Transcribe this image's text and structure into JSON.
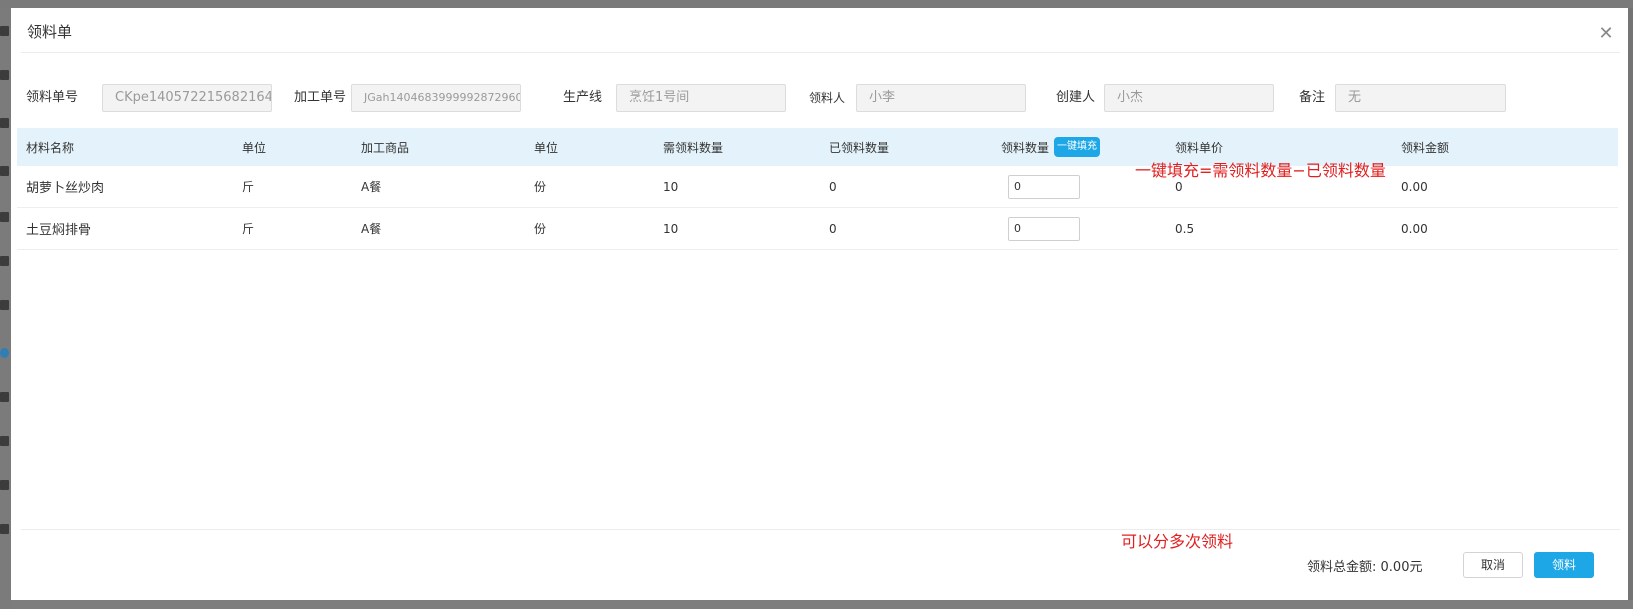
{
  "dialog": {
    "title": "领料单",
    "close_icon": "close-icon"
  },
  "form": {
    "order_no": {
      "label": "领料单号",
      "value": "CKpe140572215682164"
    },
    "process_no": {
      "label": "加工单号",
      "value": "JGah1404683999992872960"
    },
    "production_line": {
      "label": "生产线",
      "value": "烹饪1号间"
    },
    "receiver": {
      "label": "领料人",
      "value": "小李"
    },
    "creator": {
      "label": "创建人",
      "value": "小杰"
    },
    "remark": {
      "label": "备注",
      "value": "无"
    }
  },
  "table": {
    "headers": {
      "material_name": "材料名称",
      "unit": "单位",
      "product": "加工商品",
      "product_unit": "单位",
      "required_qty": "需领料数量",
      "received_qty": "已领料数量",
      "pick_qty": "领料数量",
      "fill_button": "一键填充",
      "unit_price": "领料单价",
      "amount": "领料金额"
    },
    "rows": [
      {
        "material_name": "胡萝卜丝炒肉",
        "unit": "斤",
        "product": "A餐",
        "product_unit": "份",
        "required_qty": "10",
        "received_qty": "0",
        "pick_qty": "0",
        "unit_price": "0",
        "amount": "0.00"
      },
      {
        "material_name": "土豆焖排骨",
        "unit": "斤",
        "product": "A餐",
        "product_unit": "份",
        "required_qty": "10",
        "received_qty": "0",
        "pick_qty": "0",
        "unit_price": "0.5",
        "amount": "0.00"
      }
    ]
  },
  "annotations": {
    "fill_hint": "一键填充=需领料数量−已领料数量",
    "multi_hint": "可以分多次领料"
  },
  "footer": {
    "total_label": "领料总金额:",
    "total_value": "0.00元",
    "cancel_label": "取消",
    "confirm_label": "领料"
  },
  "colors": {
    "accent": "#1ea7e6",
    "table_header_bg": "#e4f3fb",
    "annotation": "#e02020"
  }
}
